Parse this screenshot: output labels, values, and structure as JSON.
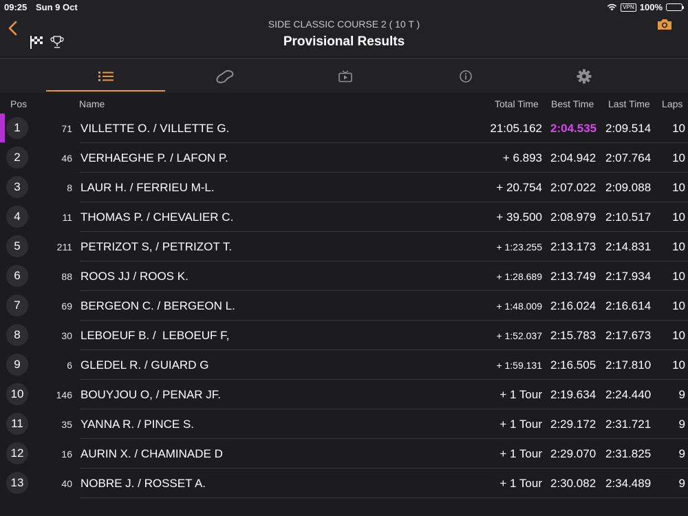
{
  "status_bar": {
    "time": "09:25",
    "date": "Sun 9 Oct",
    "vpn": "VPN",
    "battery": "100%"
  },
  "header": {
    "subtitle": "SIDE CLASSIC COURSE 2 ( 10 T )",
    "title": "Provisional Results"
  },
  "tabs": [
    {
      "icon": "list-icon",
      "active": true
    },
    {
      "icon": "track-icon",
      "active": false
    },
    {
      "icon": "tv-icon",
      "active": false
    },
    {
      "icon": "info-icon",
      "active": false
    },
    {
      "icon": "gear-icon",
      "active": false
    }
  ],
  "columns": {
    "pos": "Pos",
    "name": "Name",
    "total": "Total Time",
    "best": "Best Time",
    "last": "Last Time",
    "laps": "Laps"
  },
  "colors": {
    "accent": "#e8983a",
    "best_lap": "#d946ef",
    "leader_marker": "#b233d1"
  },
  "rows": [
    {
      "pos": "1",
      "num": "71",
      "name": "VILLETTE O. / VILLETTE G.",
      "total": "21:05.162",
      "best": "2:04.535",
      "last": "2:09.514",
      "laps": "10"
    },
    {
      "pos": "2",
      "num": "46",
      "name": "VERHAEGHE P. / LAFON P.",
      "total": "+ 6.893",
      "best": "2:04.942",
      "last": "2:07.764",
      "laps": "10"
    },
    {
      "pos": "3",
      "num": "8",
      "name": "LAUR H. / FERRIEU M-L.",
      "total": "+ 20.754",
      "best": "2:07.022",
      "last": "2:09.088",
      "laps": "10"
    },
    {
      "pos": "4",
      "num": "11",
      "name": "THOMAS P. / CHEVALIER C.",
      "total": "+ 39.500",
      "best": "2:08.979",
      "last": "2:10.517",
      "laps": "10"
    },
    {
      "pos": "5",
      "num": "211",
      "name": "PETRIZOT S, / PETRIZOT T.",
      "total": "+ 1:23.255",
      "best": "2:13.173",
      "last": "2:14.831",
      "laps": "10"
    },
    {
      "pos": "6",
      "num": "88",
      "name": "ROOS JJ / ROOS K.",
      "total": "+ 1:28.689",
      "best": "2:13.749",
      "last": "2:17.934",
      "laps": "10"
    },
    {
      "pos": "7",
      "num": "69",
      "name": "BERGEON C. / BERGEON L.",
      "total": "+ 1:48.009",
      "best": "2:16.024",
      "last": "2:16.614",
      "laps": "10"
    },
    {
      "pos": "8",
      "num": "30",
      "name": "LEBOEUF B. /  LEBOEUF F,",
      "total": "+ 1:52.037",
      "best": "2:15.783",
      "last": "2:17.673",
      "laps": "10"
    },
    {
      "pos": "9",
      "num": "6",
      "name": "GLEDEL R. / GUIARD G",
      "total": "+ 1:59.131",
      "best": "2:16.505",
      "last": "2:17.810",
      "laps": "10"
    },
    {
      "pos": "10",
      "num": "146",
      "name": "BOUYJOU O, / PENAR JF.",
      "total": "+ 1 Tour",
      "best": "2:19.634",
      "last": "2:24.440",
      "laps": "9"
    },
    {
      "pos": "11",
      "num": "35",
      "name": "YANNA R. / PINCE S.",
      "total": "+ 1 Tour",
      "best": "2:29.172",
      "last": "2:31.721",
      "laps": "9"
    },
    {
      "pos": "12",
      "num": "16",
      "name": "AURIN X. / CHAMINADE D",
      "total": "+ 1 Tour",
      "best": "2:29.070",
      "last": "2:31.825",
      "laps": "9"
    },
    {
      "pos": "13",
      "num": "40",
      "name": "NOBRE J. / ROSSET A.",
      "total": "+ 1 Tour",
      "best": "2:30.082",
      "last": "2:34.489",
      "laps": "9"
    }
  ]
}
